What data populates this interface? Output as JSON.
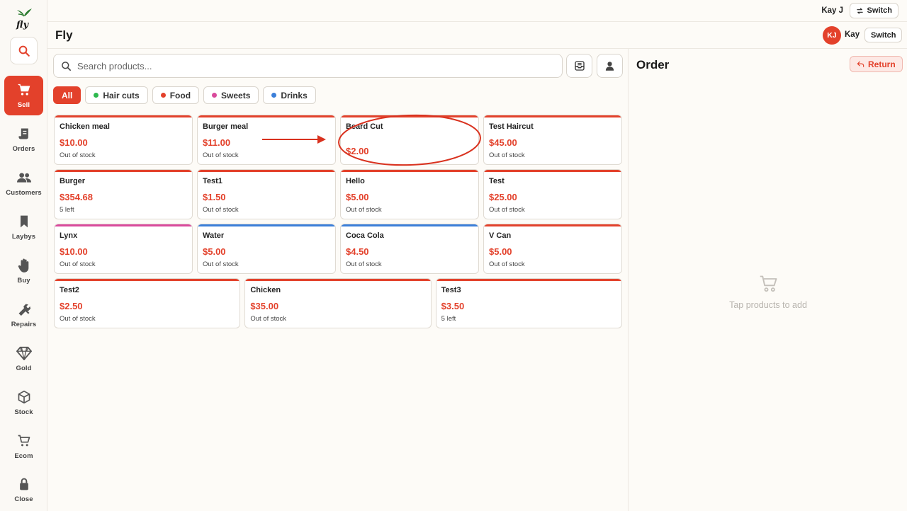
{
  "app": {
    "title": "Fly",
    "logo_icon": "fly-logo-icon"
  },
  "topbar": {
    "user_name": "Kay J",
    "switch_label": "Switch"
  },
  "header": {
    "avatar_initials": "KJ",
    "user_name": "Kay",
    "switch_label": "Switch"
  },
  "sidebar": {
    "items": [
      {
        "label": "Sell",
        "icon": "cart-icon",
        "active": true
      },
      {
        "label": "Orders",
        "icon": "receipt-icon"
      },
      {
        "label": "Customers",
        "icon": "users-icon"
      },
      {
        "label": "Laybys",
        "icon": "bookmark-icon"
      },
      {
        "label": "Buy",
        "icon": "hand-icon"
      },
      {
        "label": "Repairs",
        "icon": "tools-icon"
      },
      {
        "label": "Gold",
        "icon": "diamond-icon"
      },
      {
        "label": "Stock",
        "icon": "box-icon"
      },
      {
        "label": "Ecom",
        "icon": "shopping-cart-icon"
      },
      {
        "label": "Close",
        "icon": "lock-icon"
      }
    ]
  },
  "search": {
    "placeholder": "Search products..."
  },
  "filters": [
    {
      "label": "All",
      "active": true
    },
    {
      "label": "Hair cuts",
      "color": "#2db84d"
    },
    {
      "label": "Food",
      "color": "#e3412b"
    },
    {
      "label": "Sweets",
      "color": "#d94a9c"
    },
    {
      "label": "Drinks",
      "color": "#3b7fd9"
    }
  ],
  "products": {
    "rows": [
      [
        {
          "name": "Chicken meal",
          "price": "$10.00",
          "stock": "Out of stock",
          "color": "#e3412b"
        },
        {
          "name": "Burger meal",
          "price": "$11.00",
          "stock": "Out of stock",
          "color": "#e3412b"
        },
        {
          "name": "Beard Cut",
          "price": "$2.00",
          "stock": "",
          "color": "#e3412b"
        },
        {
          "name": "Test Haircut",
          "price": "$45.00",
          "stock": "Out of stock",
          "color": "#e3412b"
        }
      ],
      [
        {
          "name": "Burger",
          "price": "$354.68",
          "stock": "5 left",
          "color": "#e3412b"
        },
        {
          "name": "Test1",
          "price": "$1.50",
          "stock": "Out of stock",
          "color": "#e3412b"
        },
        {
          "name": "Hello",
          "price": "$5.00",
          "stock": "Out of stock",
          "color": "#e3412b"
        },
        {
          "name": "Test",
          "price": "$25.00",
          "stock": "Out of stock",
          "color": "#e3412b"
        }
      ],
      [
        {
          "name": "Lynx",
          "price": "$10.00",
          "stock": "Out of stock",
          "color": "#d94a9c"
        },
        {
          "name": "Water",
          "price": "$5.00",
          "stock": "Out of stock",
          "color": "#3b7fd9"
        },
        {
          "name": "Coca Cola",
          "price": "$4.50",
          "stock": "Out of stock",
          "color": "#3b7fd9"
        },
        {
          "name": "V Can",
          "price": "$5.00",
          "stock": "Out of stock",
          "color": "#e3412b"
        }
      ],
      [
        {
          "name": "Test2",
          "price": "$2.50",
          "stock": "Out of stock",
          "color": "#e3412b"
        },
        {
          "name": "Chicken",
          "price": "$35.00",
          "stock": "Out of stock",
          "color": "#e3412b"
        },
        {
          "name": "Test3",
          "price": "$3.50",
          "stock": "5 left",
          "color": "#e3412b"
        }
      ]
    ]
  },
  "order": {
    "title": "Order",
    "return_label": "Return",
    "empty_text": "Tap products to add"
  },
  "colors": {
    "accent": "#e3412b",
    "annotation": "#d9321f"
  }
}
